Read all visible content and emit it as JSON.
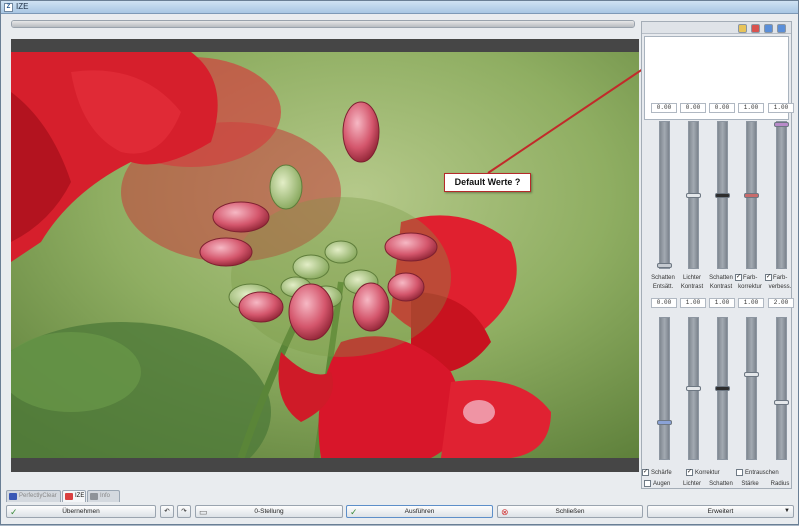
{
  "window": {
    "title": "IZE"
  },
  "progress": {
    "value": 1.0
  },
  "annotation": {
    "text": "Default Werte ?"
  },
  "preset_toolbar": {
    "buttons": [
      {
        "icon": "folder-open-icon",
        "color": "#e8c45a"
      },
      {
        "icon": "delete-icon",
        "color": "#d9534f"
      },
      {
        "icon": "arrow-up-icon",
        "color": "#5b8fd9"
      },
      {
        "icon": "arrow-down-icon",
        "color": "#5b8fd9"
      }
    ]
  },
  "upper_sliders": {
    "values": [
      "0.00",
      "0.00",
      "0.00",
      "1.00",
      "1.00"
    ],
    "levels": [
      0.0,
      0.5,
      0.5,
      0.5,
      1.0
    ],
    "thumb_colors": [
      "#c4c9cf",
      "#e4e7ea",
      "#2d2d2d",
      "#c86b6b",
      "#b98bc9"
    ],
    "labels_top": [
      "Schatten",
      "Lichter",
      "Schatten",
      "Farb-",
      "Farb-"
    ],
    "labels_bottom": [
      "Entsätt.",
      "Kontrast",
      "Kontrast",
      "korrektur",
      "verbess."
    ],
    "checkboxes": [
      null,
      null,
      null,
      true,
      true
    ]
  },
  "lower_sliders": {
    "values": [
      "0.00",
      "1.00",
      "1.00",
      "1.00",
      "2.00"
    ],
    "levels": [
      0.25,
      0.5,
      0.5,
      0.6,
      0.4
    ],
    "thumb_colors": [
      "#8aa2d6",
      "#e4e7ea",
      "#2d2d2d",
      "#e4e7ea",
      "#e4e7ea"
    ],
    "row1": [
      {
        "label": "Schärfe",
        "checked": true
      },
      {
        "label": "Korrektur",
        "checked": true
      },
      {
        "label": "Entrauschen",
        "checked": false
      }
    ],
    "row2": [
      {
        "label": "Augen",
        "checked": false
      },
      {
        "label": "Lichter",
        "checked": null
      },
      {
        "label": "Schatten",
        "checked": null
      },
      {
        "label": "Stärke",
        "checked": null
      },
      {
        "label": "Radius",
        "checked": null
      }
    ]
  },
  "tabs": [
    {
      "label": "PerfectlyClear",
      "icon_color": "#3a58b5",
      "active": false
    },
    {
      "label": "IZE",
      "icon_color": "#d94040",
      "active": true
    },
    {
      "label": "Info",
      "icon_color": "#8e9399",
      "active": false
    }
  ],
  "bottom_bar": {
    "apply_label": "Übernehmen",
    "undo_icon": "undo-icon",
    "redo_icon": "redo-icon",
    "zero_label": "0-Stellung",
    "run_label": "Ausführen",
    "close_label": "Schließen",
    "extended_label": "Erweitert"
  }
}
